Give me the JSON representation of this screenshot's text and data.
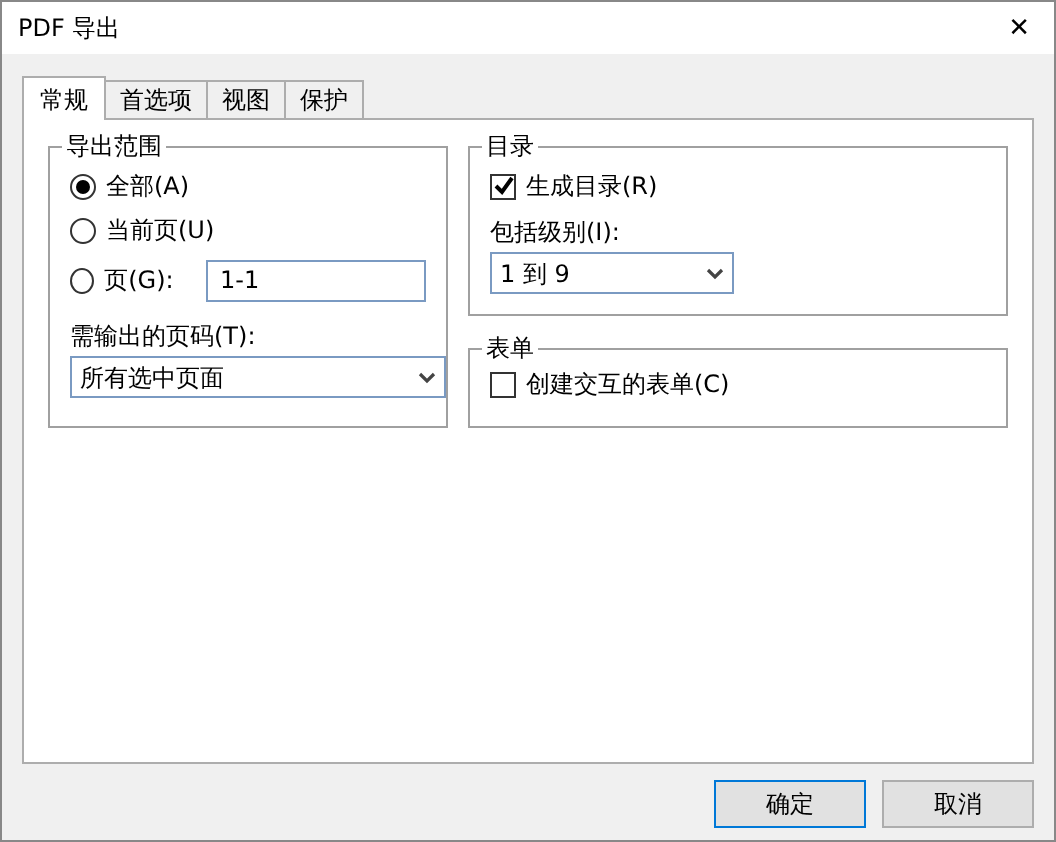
{
  "window": {
    "title": "PDF 导出",
    "close": "✕"
  },
  "tabs": [
    {
      "label": "常规",
      "selected": true
    },
    {
      "label": "首选项",
      "selected": false
    },
    {
      "label": "视图",
      "selected": false
    },
    {
      "label": "保护",
      "selected": false
    }
  ],
  "export_range": {
    "title": "导出范围",
    "options": [
      {
        "label": "全部(A)",
        "selected": true
      },
      {
        "label": "当前页(U)",
        "selected": false
      },
      {
        "label": "页(G):",
        "selected": false,
        "value": "1-1"
      }
    ],
    "pages_label": "需输出的页码(T):",
    "pages_value": "所有选中页面"
  },
  "toc": {
    "title": "目录",
    "checkbox": {
      "label": "生成目录(R)",
      "checked": true
    },
    "levels_label": "包括级别(I):",
    "levels_value": "1 到 9"
  },
  "form": {
    "title": "表单",
    "checkbox": {
      "label": "创建交互的表单(C)",
      "checked": false
    }
  },
  "buttons": [
    {
      "label": "确定",
      "kind": "default"
    },
    {
      "label": "取消",
      "kind": "normal"
    }
  ]
}
